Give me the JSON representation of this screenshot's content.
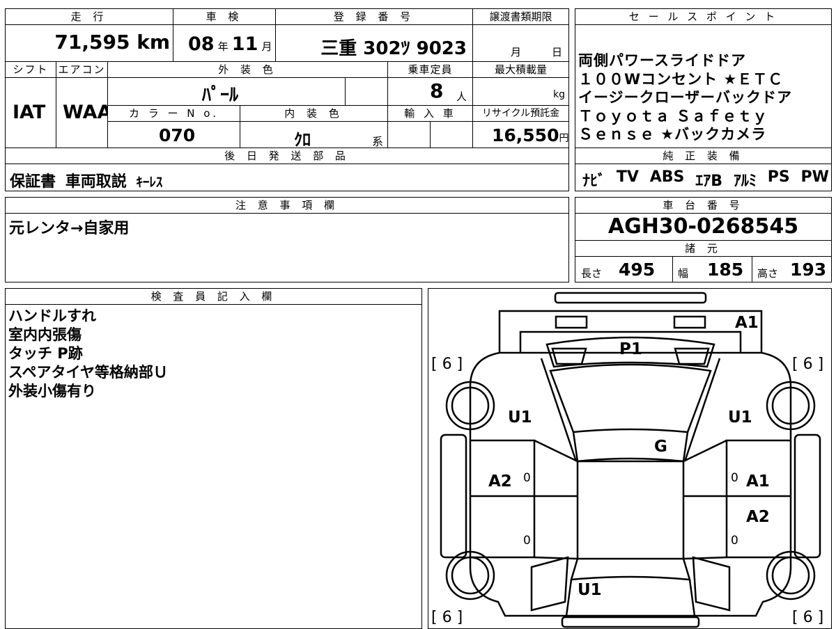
{
  "vehicle": {
    "labels": {
      "mileage": "走 行",
      "inspection": "車 検",
      "registration": "登 録 番 号",
      "transfer_deadline": "譲渡書類期限",
      "shift": "シフト",
      "aircon": "エアコン",
      "exterior_color": "外 装 色",
      "capacity": "乗車定員",
      "max_load": "最大積載量",
      "color_no": "カ ラ ー N o.",
      "interior_color": "内 装 色",
      "import": "輸 入 車",
      "recycle": "リサイクル預託金"
    },
    "mileage": "71,595 km",
    "inspection_year": "08",
    "inspection_year_unit": "年",
    "inspection_month": "11",
    "inspection_month_unit": "月",
    "registration_number": "三重 302ﾂ 9023",
    "transfer_month_unit": "月",
    "transfer_day_unit": "日",
    "shift": "IAT",
    "aircon": "WAA",
    "exterior_color": "ﾊﾟｰﾙ",
    "capacity": "8",
    "capacity_unit": "人",
    "max_load_unit": "kg",
    "color_no": "070",
    "interior_color": "ｸﾛ",
    "interior_color_unit": "系",
    "recycle_fee": "16,550",
    "recycle_unit": "円"
  },
  "sales_points": {
    "title": "セ ー ル ス ポ イ ン ト",
    "lines": [
      "両側パワースライドドア",
      "１００Wコンセント ★ＥＴＣ",
      "イージークローザーバックドア",
      "Ｔｏｙｏｔａ Ｓａｆｅｔｙ",
      "Ｓｅｎｓｅ ★バックカメラ"
    ]
  },
  "accessories": {
    "title": "後 日 発 送 部 品",
    "items": [
      "保証書",
      "車両取説",
      "ｷｰﾚｽ"
    ]
  },
  "genuine": {
    "title": "純 正 装 備",
    "items": [
      "ﾅﾋﾞ",
      "TV",
      "ABS",
      "ｴｱB",
      "ｱﾙﾐ",
      "PS",
      "PW"
    ]
  },
  "notes": {
    "title": "注 意 事 項 欄",
    "text": "元レンタ→自家用"
  },
  "chassis": {
    "title": "車 台 番 号",
    "value": "AGH30-0268545"
  },
  "specs": {
    "title": "諸 元",
    "length_label": "長さ",
    "length": "495",
    "width_label": "幅",
    "width": "185",
    "height_label": "高さ",
    "height": "193"
  },
  "inspector": {
    "title": "検 査 員 記 入 欄",
    "lines": [
      "ハンドルすれ",
      "室内内張傷",
      "タッチ P跡",
      "スペアタイヤ等格納部Ｕ",
      "外装小傷有り"
    ]
  },
  "diagram": {
    "tire_top_left": "[ 6 ]",
    "tire_top_right": "[ 6 ]",
    "tire_bottom_left": "[ 6 ]",
    "tire_bottom_right": "[ 6 ]",
    "marks": {
      "front_right": "A1",
      "hood": "P1",
      "left_front": "U1",
      "right_front": "U1",
      "windshield": "G",
      "left_door_front": "A2",
      "right_door_front": "A1",
      "right_door_rear": "A2",
      "rear": "U1",
      "zero1": "0",
      "zero2": "0",
      "zero3": "0",
      "zero4": "0"
    }
  }
}
